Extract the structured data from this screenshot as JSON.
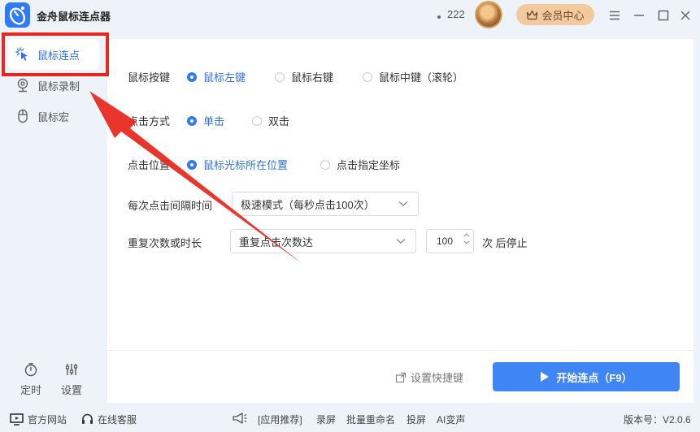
{
  "app": {
    "title": "金舟鼠标连点器"
  },
  "topbar": {
    "coins": "222",
    "member_label": "会员中心"
  },
  "sidebar": {
    "items": [
      {
        "label": "鼠标连点",
        "icon": "cursor-click-icon",
        "active": true
      },
      {
        "label": "鼠标录制",
        "icon": "webcam-icon",
        "active": false
      },
      {
        "label": "鼠标宏",
        "icon": "mouse-icon",
        "active": false
      }
    ],
    "bottom": [
      {
        "label": "定时",
        "icon": "timer-icon"
      },
      {
        "label": "设置",
        "icon": "sliders-icon"
      }
    ]
  },
  "settings": {
    "mouse_button": {
      "label": "鼠标按键",
      "options": [
        "鼠标左键",
        "鼠标右键",
        "鼠标中键（滚轮）"
      ],
      "selected": "鼠标左键"
    },
    "click_type": {
      "label": "点击方式",
      "options": [
        "单击",
        "双击"
      ],
      "selected": "单击"
    },
    "click_position": {
      "label": "点击位置",
      "options": [
        "鼠标光标所在位置",
        "点击指定坐标"
      ],
      "selected": "鼠标光标所在位置"
    },
    "interval": {
      "label": "每次点击间隔时间",
      "value": "极速模式（每秒点击100次）"
    },
    "repeat": {
      "label": "重复次数或时长",
      "mode_value": "重复点击次数达",
      "count": "100",
      "suffix": "次 后停止"
    }
  },
  "actions": {
    "hotkey_label": "设置快捷键",
    "start_label": "开始连点（F9）"
  },
  "statusbar": {
    "website": "官方网站",
    "support": "在线客服",
    "apps_label": "[应用推荐]",
    "apps": [
      "录屏",
      "批量重命名",
      "投屏",
      "AI变声"
    ],
    "version": "版本号：V2.0.6"
  },
  "colors": {
    "accent": "#2f7bf5",
    "annotation": "#e8261d",
    "member": "#f3c99e"
  }
}
